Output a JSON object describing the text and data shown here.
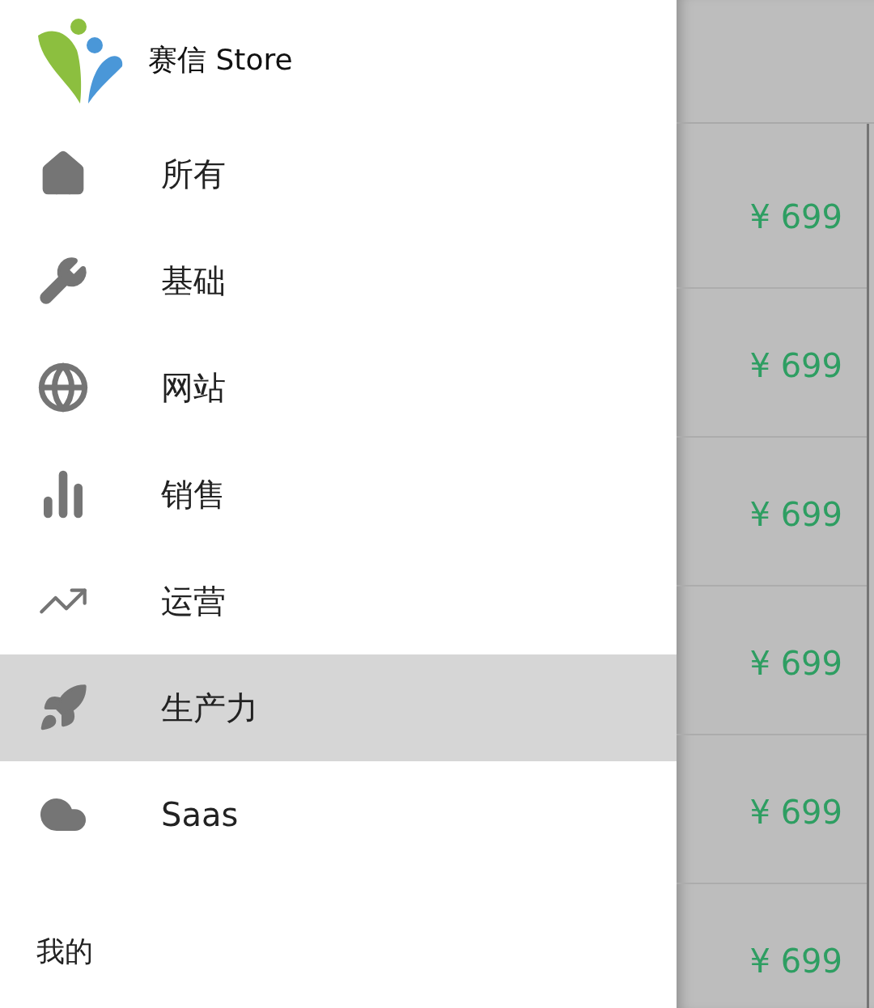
{
  "drawer": {
    "title": "赛信 Store",
    "items": [
      {
        "label": "所有",
        "selected": false
      },
      {
        "label": "基础",
        "selected": false
      },
      {
        "label": "网站",
        "selected": false
      },
      {
        "label": "销售",
        "selected": false
      },
      {
        "label": "运营",
        "selected": false
      },
      {
        "label": "生产力",
        "selected": true
      },
      {
        "label": "Saas",
        "selected": false
      }
    ],
    "section": "我的"
  },
  "products": [
    {
      "price": "¥ 699"
    },
    {
      "price": "¥ 699"
    },
    {
      "price": "¥ 699"
    },
    {
      "price": "¥ 699"
    },
    {
      "price": "¥ 699"
    },
    {
      "price": "¥ 699"
    }
  ]
}
